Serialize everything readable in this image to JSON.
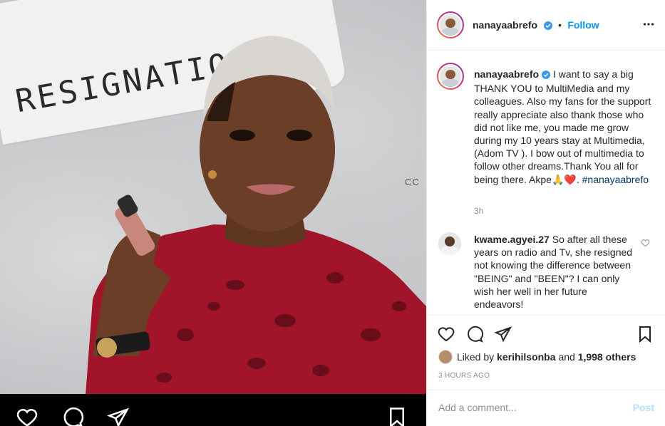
{
  "media": {
    "overlay_text": "RESIGNATION",
    "side_logo": "CC",
    "colors": {
      "dress": "#a1142a",
      "skin": "#6b3f27",
      "wall": "#c4c6c8"
    },
    "bottom_icons": [
      "heart-icon",
      "comment-icon",
      "share-icon",
      "bookmark-icon"
    ]
  },
  "header": {
    "username": "nanayaabrefo",
    "verified": true,
    "separator": "•",
    "follow_label": "Follow",
    "more_icon": "ellipsis-icon"
  },
  "caption": {
    "username": "nanayaabrefo",
    "text": "I want to say a big THANK YOU to MultiMedia and my colleagues. Also my fans for the support really appreciate also thank those who did not like me, you made me grow during my 10 years stay at Multimedia, (Adom TV ). I bow out of multimedia to follow other dreams.Thank You all for being there. Akpe",
    "emojis": "🙏❤️",
    "after_emoji": ". ",
    "hashtag": "#nanayaabrefo",
    "time": "3h"
  },
  "comments": [
    {
      "username": "kwame.agyei.27",
      "text": "So after all these years on radio and Tv, she resigned not knowing the difference between \"BEING\" and \"BEEN\"? I can only wish her well in her future endeavors!"
    }
  ],
  "actions": {
    "icons": [
      "heart-icon",
      "comment-icon",
      "share-icon",
      "bookmark-icon"
    ],
    "liked_prefix": "Liked by",
    "liked_user": "kerihilsonba",
    "liked_and": "and",
    "liked_others": "1,998 others",
    "timestamp": "3 HOURS AGO"
  },
  "add_comment": {
    "placeholder": "Add a comment...",
    "post_label": "Post"
  },
  "colors": {
    "accent": "#0095f6",
    "post_disabled": "#b2dffc",
    "hashtag": "#00376b",
    "muted": "#8e8e8e"
  }
}
